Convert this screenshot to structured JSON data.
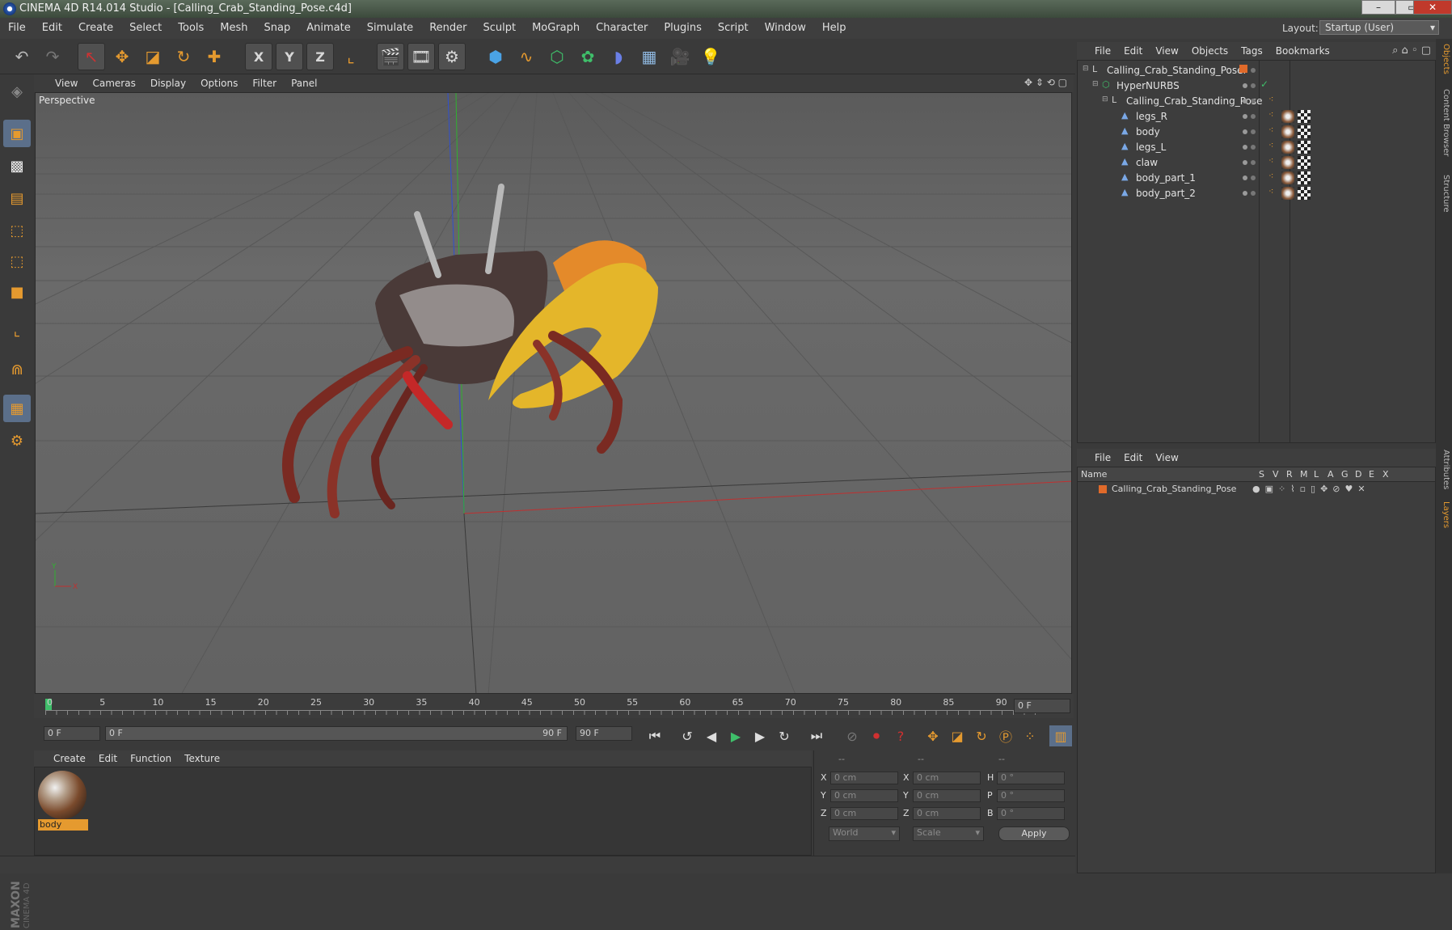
{
  "window": {
    "title": "CINEMA 4D R14.014 Studio - [Calling_Crab_Standing_Pose.c4d]",
    "buttons": [
      "–",
      "▭",
      "✕"
    ]
  },
  "menubar": {
    "items": [
      "File",
      "Edit",
      "Create",
      "Select",
      "Tools",
      "Mesh",
      "Snap",
      "Animate",
      "Simulate",
      "Render",
      "Sculpt",
      "MoGraph",
      "Character",
      "Plugins",
      "Script",
      "Window",
      "Help"
    ],
    "layout_label": "Layout:",
    "layout_value": "Startup (User)"
  },
  "toolbar": {
    "icons": [
      "undo-icon",
      "redo-icon",
      "live-select-icon",
      "move-icon",
      "scale-icon",
      "rotate-icon",
      "add-icon",
      "x-axis-icon",
      "y-axis-icon",
      "z-axis-icon",
      "coordinate-system-icon",
      "render-view-icon",
      "render-picture-viewer-icon",
      "render-settings-icon",
      "cube-icon",
      "spline-icon",
      "nurbs-icon",
      "array-icon",
      "deformer-icon",
      "floor-icon",
      "camera-icon",
      "light-icon"
    ],
    "axis_labels": [
      "X",
      "Y",
      "Z"
    ]
  },
  "viewport": {
    "menu": [
      "View",
      "Cameras",
      "Display",
      "Options",
      "Filter",
      "Panel"
    ],
    "label": "Perspective"
  },
  "timeline": {
    "ticks": [
      "0",
      "5",
      "10",
      "15",
      "20",
      "25",
      "30",
      "35",
      "40",
      "45",
      "50",
      "55",
      "60",
      "65",
      "70",
      "75",
      "80",
      "85",
      "90"
    ],
    "current_frame": "0 F",
    "start_field": "0 F",
    "range_start": "0 F",
    "range_end": "90 F",
    "end_field": "90 F"
  },
  "materials": {
    "menu": [
      "Create",
      "Edit",
      "Function",
      "Texture"
    ],
    "items": [
      {
        "name": "body"
      }
    ]
  },
  "coordinates": {
    "headers": [
      "--",
      "--",
      "--"
    ],
    "rows": [
      {
        "axis": "X",
        "pos": "0 cm",
        "axis2": "X",
        "size": "0 cm",
        "rot_label": "H",
        "rot": "0 °"
      },
      {
        "axis": "Y",
        "pos": "0 cm",
        "axis2": "Y",
        "size": "0 cm",
        "rot_label": "P",
        "rot": "0 °"
      },
      {
        "axis": "Z",
        "pos": "0 cm",
        "axis2": "Z",
        "size": "0 cm",
        "rot_label": "B",
        "rot": "0 °"
      }
    ],
    "mode1": "World",
    "mode2": "Scale",
    "apply": "Apply"
  },
  "objects_manager": {
    "menu": [
      "File",
      "Edit",
      "View",
      "Objects",
      "Tags",
      "Bookmarks"
    ],
    "tree": [
      {
        "name": "Calling_Crab_Standing_Posef",
        "depth": 0
      },
      {
        "name": "HyperNURBS",
        "depth": 1
      },
      {
        "name": "Calling_Crab_Standing_Pose",
        "depth": 2
      },
      {
        "name": "legs_R",
        "depth": 3
      },
      {
        "name": "body",
        "depth": 3
      },
      {
        "name": "legs_L",
        "depth": 3
      },
      {
        "name": "claw",
        "depth": 3
      },
      {
        "name": "body_part_1",
        "depth": 3
      },
      {
        "name": "body_part_2",
        "depth": 3
      }
    ]
  },
  "layers_manager": {
    "menu": [
      "File",
      "Edit",
      "View"
    ],
    "header": {
      "name": "Name",
      "flags": [
        "S",
        "V",
        "R",
        "M",
        "L",
        "A",
        "G",
        "D",
        "E",
        "X"
      ]
    },
    "rows": [
      {
        "name": "Calling_Crab_Standing_Pose",
        "color": "#e06a2a"
      }
    ]
  },
  "side_tabs": [
    "Objects",
    "Content Browser",
    "Structure",
    "Attributes",
    "Layers"
  ],
  "colors": {
    "accent": "#e59a2f",
    "selection": "#5b6f8a",
    "x_axis": "#d03030",
    "y_axis": "#30b030",
    "z_axis": "#3050d0"
  }
}
